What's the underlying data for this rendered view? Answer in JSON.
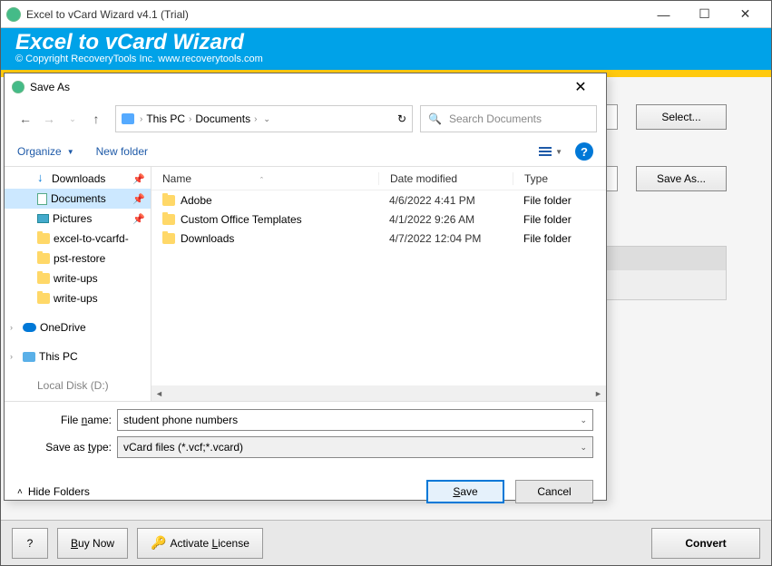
{
  "main": {
    "title": "Excel to vCard Wizard v4.1 (Trial)",
    "headerBig": "Excel to vCard Wizard",
    "headerSmall": "© Copyright RecoveryTools Inc. www.recoverytools.com",
    "selectBtn": "Select...",
    "saveAsBtn": "Save As...",
    "ribbonSelect": "elect",
    "footer": {
      "help": "?",
      "buy1": "B",
      "buy2": "uy Now",
      "activate1": "Activate ",
      "activate2": "L",
      "activate3": "icense",
      "convert": "Convert"
    }
  },
  "dlg": {
    "title": "Save As",
    "crumbs": {
      "pc": "This PC",
      "docs": "Documents"
    },
    "searchPlaceholder": "Search Documents",
    "toolbar": {
      "organize": "Organize",
      "newFolder": "New folder"
    },
    "tree": {
      "downloads": "Downloads",
      "documents": "Documents",
      "pictures": "Pictures",
      "excel": "excel-to-vcarfd-",
      "pst": "pst-restore",
      "write1": "write-ups",
      "write2": "write-ups",
      "onedrive": "OneDrive",
      "thispc": "This PC",
      "local": "Local Disk (D:)"
    },
    "cols": {
      "name": "Name",
      "date": "Date modified",
      "type": "Type"
    },
    "rows": [
      {
        "name": "Adobe",
        "date": "4/6/2022 4:41 PM",
        "type": "File folder"
      },
      {
        "name": "Custom Office Templates",
        "date": "4/1/2022 9:26 AM",
        "type": "File folder"
      },
      {
        "name": "Downloads",
        "date": "4/7/2022 12:04 PM",
        "type": "File folder"
      }
    ],
    "fileNameLabel1": "File ",
    "fileNameLabel2": "n",
    "fileNameLabel3": "ame:",
    "fileNameValue": "student phone numbers",
    "saveTypeLabel1": "Save as ",
    "saveTypeLabel2": "t",
    "saveTypeLabel3": "ype:",
    "saveTypeValue": "vCard files (*.vcf;*.vcard)",
    "hideFolders": "Hide Folders",
    "saveBtn1": "S",
    "saveBtn2": "ave",
    "cancelBtn": "Cancel"
  }
}
